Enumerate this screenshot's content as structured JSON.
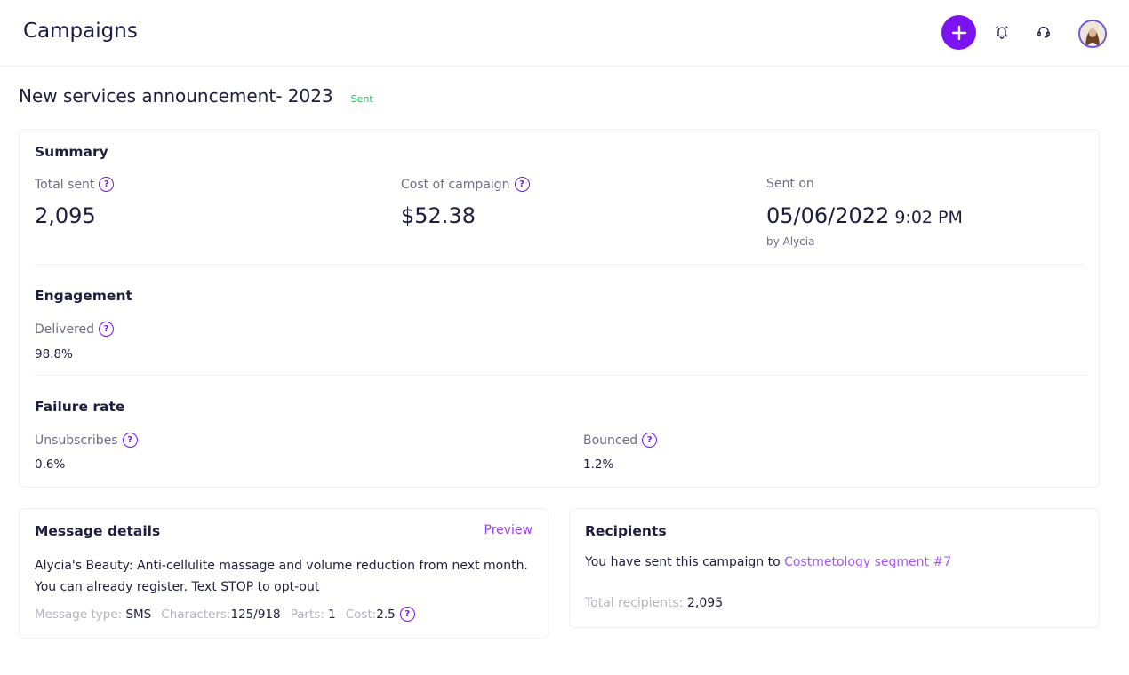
{
  "header": {
    "title": "Campaigns",
    "add_icon": "plus-icon",
    "bell_icon": "bell-icon",
    "support_icon": "headset-icon",
    "avatar_icon": "user-avatar"
  },
  "campaign": {
    "title": "New services announcement- 2023",
    "status": "Sent"
  },
  "summary": {
    "title": "Summary",
    "total_sent_label": "Total sent",
    "total_sent_value": "2,095",
    "cost_label": "Cost of campaign",
    "cost_value": "$52.38",
    "sent_on_label": "Sent on",
    "sent_on_date": "05/06/2022",
    "sent_on_time": "9:02 PM",
    "sent_by": "by Alycia"
  },
  "engagement": {
    "title": "Engagement",
    "delivered_label": "Delivered",
    "delivered_value": "98.8%"
  },
  "failure": {
    "title": "Failure rate",
    "unsubscribes_label": "Unsubscribes",
    "unsubscribes_value": "0.6%",
    "bounced_label": "Bounced",
    "bounced_value": "1.2%"
  },
  "message": {
    "title": "Message details",
    "preview_label": "Preview",
    "text": "Alycia's Beauty: Anti-cellulite massage and volume reduction from next month. You can already register. Text STOP to opt-out",
    "type_label": "Message type:",
    "type_value": "SMS",
    "chars_label": "Characters:",
    "chars_value": "125/918",
    "parts_label": "Parts:",
    "parts_value": "1",
    "cost_label": "Cost:",
    "cost_value": "2.5"
  },
  "recipients": {
    "title": "Recipients",
    "sent_to_text": "You have sent this campaign to ",
    "segment_link": "Costmetology segment #7",
    "total_label": "Total recipients:",
    "total_value": "2,095"
  },
  "colors": {
    "accent": "#7b13f0",
    "link": "#a855f7",
    "status_sent": "#22c55e",
    "text_primary": "#1d1d3f",
    "text_muted": "#6d6d86"
  }
}
